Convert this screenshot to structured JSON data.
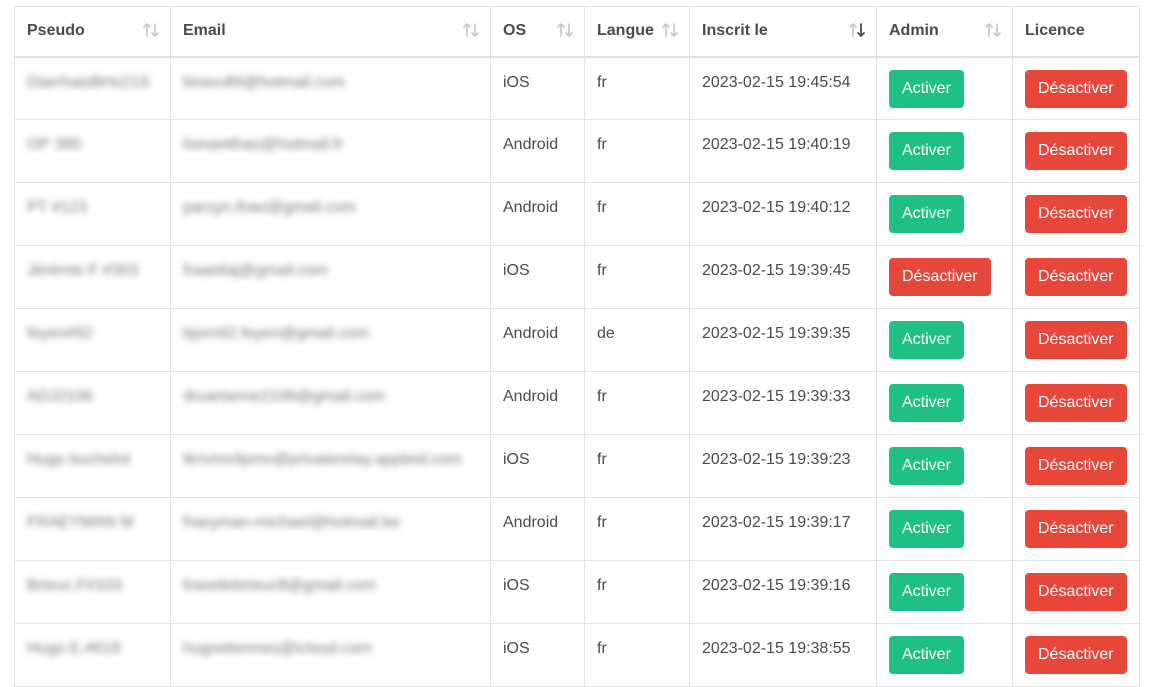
{
  "columns": [
    {
      "label": "Pseudo",
      "sortable": true,
      "sort": "none"
    },
    {
      "label": "Email",
      "sortable": true,
      "sort": "none"
    },
    {
      "label": "OS",
      "sortable": true,
      "sort": "none"
    },
    {
      "label": "Langue",
      "sortable": true,
      "sort": "none"
    },
    {
      "label": "Inscrit le",
      "sortable": true,
      "sort": "desc"
    },
    {
      "label": "Admin",
      "sortable": true,
      "sort": "none"
    },
    {
      "label": "Licence",
      "sortable": false,
      "sort": "none"
    }
  ],
  "colors": {
    "activer": "#1fc083",
    "desactiver": "#e7473a",
    "border": "#e3e4ea"
  },
  "icons": {
    "sort_none": "sort-arrows-icon",
    "sort_desc": "sort-desc-icon"
  },
  "rows": [
    {
      "pseudo": "DiarrhaisBHs21S",
      "email": "biravull9@hotmail.com",
      "os": "iOS",
      "langue": "fr",
      "inscrit": "2023-02-15 19:45:54",
      "admin": "Activer",
      "licence": "Désactiver"
    },
    {
      "pseudo": "OP 380",
      "email": "lionaetthao@hotmail.fr",
      "os": "Android",
      "langue": "fr",
      "inscrit": "2023-02-15 19:40:19",
      "admin": "Activer",
      "licence": "Désactiver"
    },
    {
      "pseudo": "PT #123",
      "email": "parsyn.thao@gmail.com",
      "os": "Android",
      "langue": "fr",
      "inscrit": "2023-02-15 19:40:12",
      "admin": "Activer",
      "licence": "Désactiver"
    },
    {
      "pseudo": "Jérémie F #303",
      "email": "fraaeliaj@gmail.com",
      "os": "iOS",
      "langue": "fr",
      "inscrit": "2023-02-15 19:39:45",
      "admin": "Désactiver",
      "licence": "Désactiver"
    },
    {
      "pseudo": "feyen#92",
      "email": "bjorn92.feyen@gmail.com",
      "os": "Android",
      "langue": "de",
      "inscrit": "2023-02-15 19:39:35",
      "admin": "Activer",
      "licence": "Désactiver"
    },
    {
      "pseudo": "ADJ2106",
      "email": "druartanne2106@gmail.com",
      "os": "Android",
      "langue": "fr",
      "inscrit": "2023-02-15 19:39:33",
      "admin": "Activer",
      "licence": "Désactiver"
    },
    {
      "pseudo": "Hugo buchelot",
      "email": "tknvmx9pmv@privaterelay.appleid.com",
      "os": "iOS",
      "langue": "fr",
      "inscrit": "2023-02-15 19:39:23",
      "admin": "Activer",
      "licence": "Désactiver"
    },
    {
      "pseudo": "FRAEYMAN M",
      "email": "fraeyman-michael@hotmail.be",
      "os": "Android",
      "langue": "fr",
      "inscrit": "2023-02-15 19:39:17",
      "admin": "Activer",
      "licence": "Désactiver"
    },
    {
      "pseudo": "Brieuc.F#103",
      "email": "fraseliebrieuc8@gmail.com",
      "os": "iOS",
      "langue": "fr",
      "inscrit": "2023-02-15 19:39:16",
      "admin": "Activer",
      "licence": "Désactiver"
    },
    {
      "pseudo": "Hugo E.#618",
      "email": "hugoetiennes@icloud.com",
      "os": "iOS",
      "langue": "fr",
      "inscrit": "2023-02-15 19:38:55",
      "admin": "Activer",
      "licence": "Désactiver"
    }
  ]
}
